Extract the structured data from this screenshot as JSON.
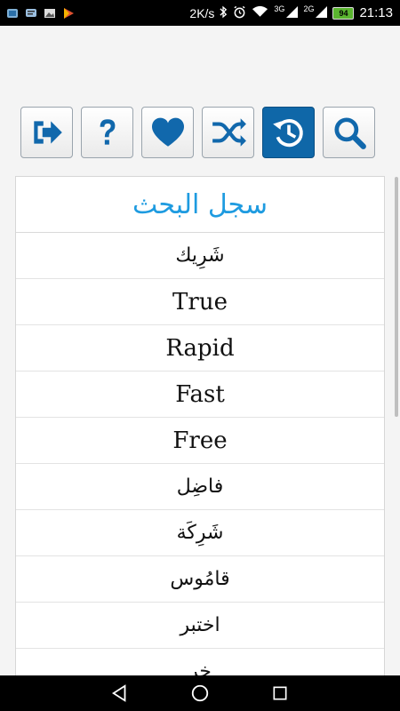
{
  "status_bar": {
    "network_speed": "2K/s",
    "signal1_tag": "3G",
    "signal2_tag": "2G",
    "battery": "94",
    "time": "21:13"
  },
  "toolbar": {
    "buttons": [
      {
        "icon": "exit-icon"
      },
      {
        "icon": "help-icon"
      },
      {
        "icon": "favorite-icon"
      },
      {
        "icon": "shuffle-icon"
      },
      {
        "icon": "history-icon",
        "active": true
      },
      {
        "icon": "search-icon"
      }
    ]
  },
  "history": {
    "title": "سجل البحث",
    "items": [
      "شَرِيك",
      "True",
      "Rapid",
      "Fast",
      "Free",
      "فاضِل",
      "شَرِكَة",
      "قامُوس",
      "اختبر",
      "خر"
    ]
  },
  "colors": {
    "accent": "#1e9be0",
    "active_button": "#0f67a8",
    "icon_color": "#1168ac"
  }
}
